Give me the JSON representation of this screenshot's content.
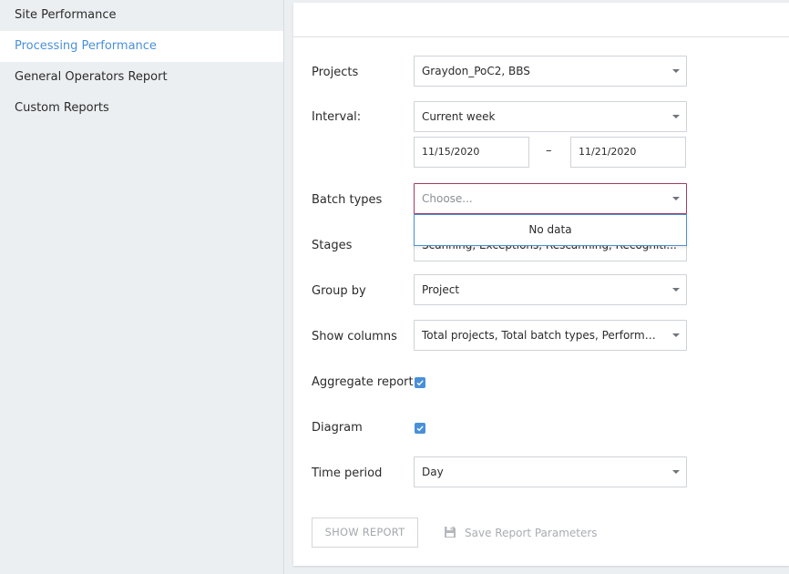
{
  "sidebar": {
    "items": [
      {
        "label": "Site Performance"
      },
      {
        "label": "Processing Performance"
      },
      {
        "label": "General Operators Report"
      },
      {
        "label": "Custom Reports"
      }
    ]
  },
  "form": {
    "projects": {
      "label": "Projects",
      "value": "Graydon_PoC2, BBS"
    },
    "interval": {
      "label": "Interval:",
      "value": "Current week",
      "start_date": "11/15/2020",
      "separator": "–",
      "end_date": "11/21/2020"
    },
    "batch_types": {
      "label": "Batch types",
      "placeholder": "Choose...",
      "dropdown_message": "No data"
    },
    "stages": {
      "label": "Stages",
      "value": "Scanning, Exceptions, Rescanning, Recogniti..."
    },
    "group_by": {
      "label": "Group by",
      "value": "Project"
    },
    "show_columns": {
      "label": "Show columns",
      "value": "Total projects, Total batch types, Performan..."
    },
    "aggregate_report": {
      "label": "Aggregate report",
      "checked": true
    },
    "diagram": {
      "label": "Diagram",
      "checked": true
    },
    "time_period": {
      "label": "Time period",
      "value": "Day"
    }
  },
  "actions": {
    "show_report": "SHOW REPORT",
    "save_params": "Save Report Parameters"
  },
  "colors": {
    "accent": "#4a90d9",
    "focus_border": "#a33c5c",
    "disabled_text": "#a9adb2"
  }
}
